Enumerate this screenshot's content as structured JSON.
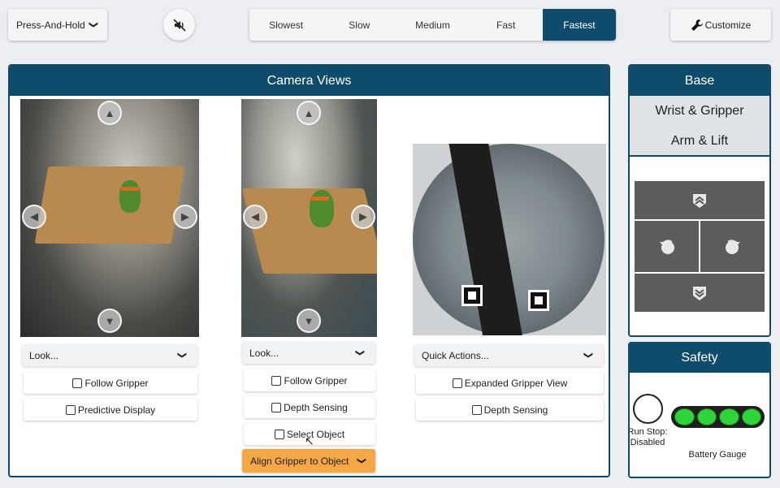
{
  "topbar": {
    "mode_label": "Press-And-Hold",
    "speeds": [
      "Slowest",
      "Slow",
      "Medium",
      "Fast",
      "Fastest"
    ],
    "active_speed": "Fastest",
    "customize_label": "Customize"
  },
  "camera_views": {
    "title": "Camera Views",
    "cam1": {
      "dropdown": "Look...",
      "buttons": [
        "Follow Gripper",
        "Predictive Display"
      ]
    },
    "cam2": {
      "dropdown": "Look...",
      "buttons": [
        "Follow Gripper",
        "Depth Sensing",
        "Select Object"
      ],
      "action": "Align Gripper to Object"
    },
    "cam3": {
      "dropdown": "Quick Actions...",
      "buttons": [
        "Expanded Gripper View",
        "Depth Sensing"
      ]
    }
  },
  "control_tabs": {
    "active": "Base",
    "items": [
      "Base",
      "Wrist & Gripper",
      "Arm & Lift"
    ]
  },
  "safety": {
    "title": "Safety",
    "runstop_label": "Run Stop: Disabled",
    "battery_label": "Battery Gauge",
    "battery_level": 1.0
  },
  "colors": {
    "accent": "#0f4c6c",
    "action": "#f5a845",
    "battery": "#2fd43a"
  }
}
